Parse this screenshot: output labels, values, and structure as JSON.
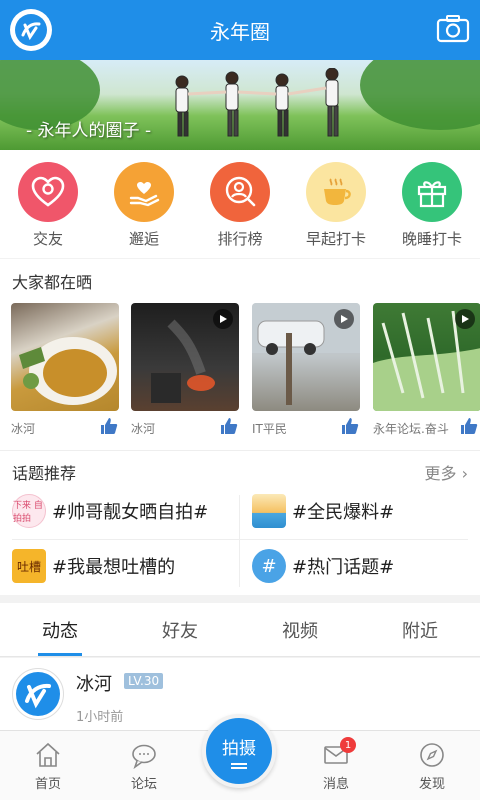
{
  "header": {
    "title": "永年圈"
  },
  "banner": {
    "caption": "- 永年人的圈子 -"
  },
  "categories": [
    {
      "label": "交友",
      "icon": "heart-camera-icon",
      "color": "#f0566a"
    },
    {
      "label": "邂逅",
      "icon": "heart-hand-icon",
      "color": "#f5a235"
    },
    {
      "label": "排行榜",
      "icon": "ranking-person-icon",
      "color": "#f0643c"
    },
    {
      "label": "早起打卡",
      "icon": "coffee-cup-icon",
      "color": "#fbe5a0"
    },
    {
      "label": "晚睡打卡",
      "icon": "gift-box-icon",
      "color": "#35c47a"
    }
  ],
  "sun": {
    "title": "大家都在晒",
    "items": [
      {
        "user": "冰河",
        "video": false
      },
      {
        "user": "冰河",
        "video": true
      },
      {
        "user": "IT平民",
        "video": true
      },
      {
        "user": "永年论坛.奋斗",
        "video": true
      }
    ]
  },
  "topics": {
    "title": "话题推荐",
    "more": "更多",
    "items": [
      {
        "text": "#帅哥靓女晒自拍#",
        "icon": "selfie-topic-icon",
        "icon_text": "下来 自拍拍"
      },
      {
        "text": "#全民爆料#",
        "icon": "swim-topic-icon"
      },
      {
        "text": "#我最想吐槽的",
        "icon": "complain-topic-icon",
        "icon_text": "吐槽"
      },
      {
        "text": "#热门话题#",
        "icon": "hashtag-topic-icon",
        "icon_text": "#"
      }
    ]
  },
  "tabs": [
    "动态",
    "好友",
    "视频",
    "附近"
  ],
  "post": {
    "name": "冰河",
    "level": "LV.30",
    "time": "1小时前"
  },
  "bottom_nav": [
    {
      "label": "首页",
      "icon": "home-icon"
    },
    {
      "label": "论坛",
      "icon": "chat-bubble-icon"
    },
    {
      "label": "",
      "icon": ""
    },
    {
      "label": "消息",
      "icon": "mail-icon",
      "badge": "1"
    },
    {
      "label": "发现",
      "icon": "compass-icon"
    }
  ],
  "shoot_button": {
    "label": "拍摄"
  }
}
